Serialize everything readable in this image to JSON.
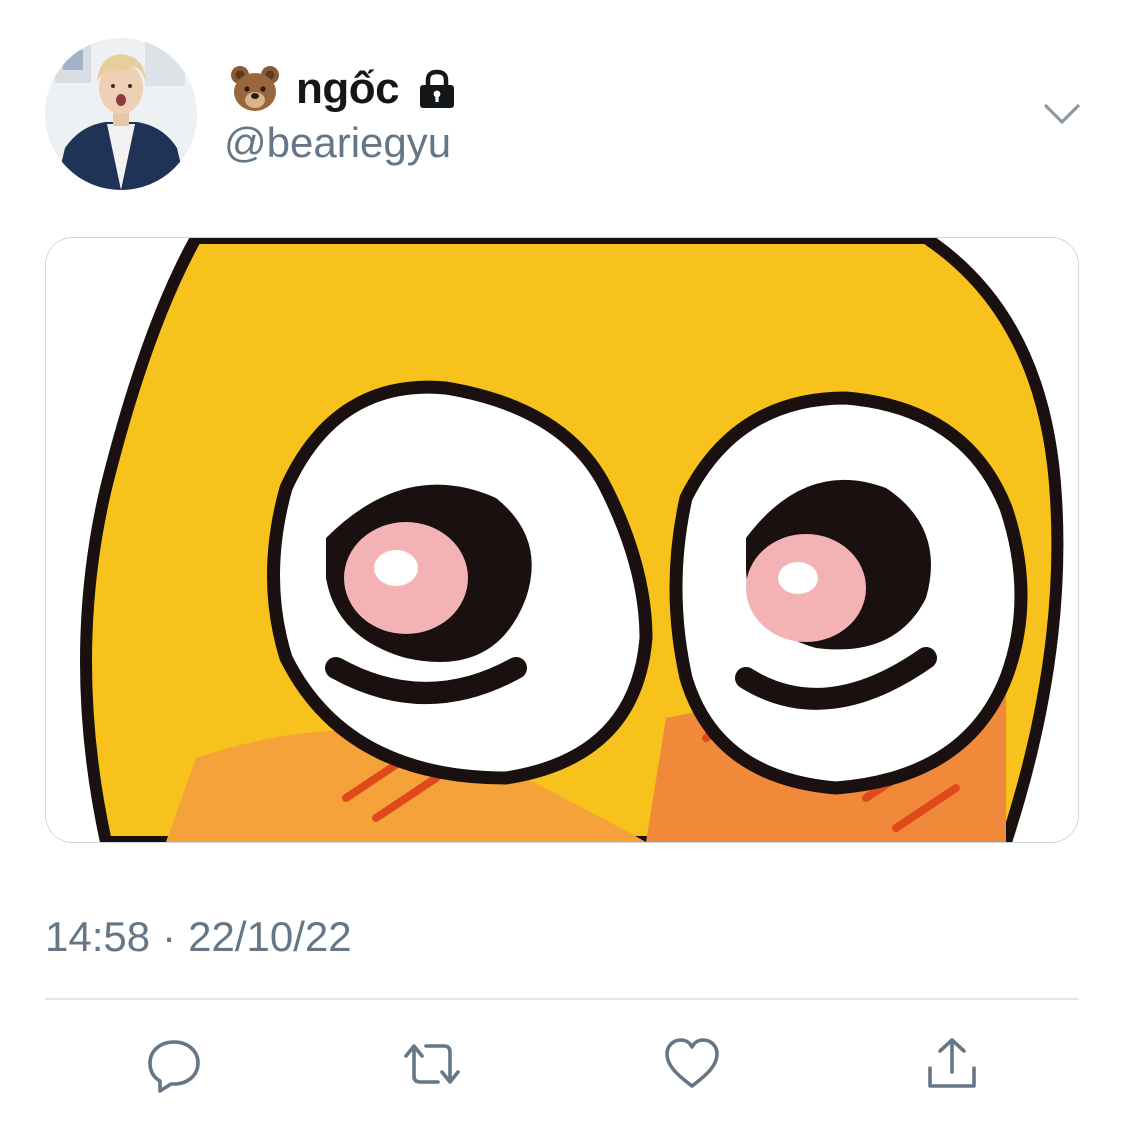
{
  "tweet": {
    "author": {
      "display_name": "ngốc",
      "handle": "@beariegyu",
      "name_emoji": "bear-face-icon",
      "protected_icon": "lock-icon",
      "avatar": "profile-photo"
    },
    "menu_icon": "chevron-down-icon",
    "media": {
      "description_icon": "duck-eyes-image"
    },
    "time": "14:58",
    "separator": "·",
    "date": "22/10/22",
    "actions": [
      {
        "name": "reply",
        "icon": "reply-icon"
      },
      {
        "name": "retweet",
        "icon": "retweet-icon"
      },
      {
        "name": "like",
        "icon": "heart-icon"
      },
      {
        "name": "share",
        "icon": "share-icon"
      }
    ]
  },
  "colors": {
    "text_primary": "#14171a",
    "text_secondary": "#657786",
    "icon_gray": "#657786",
    "border": "#ccd6dd",
    "divider": "#e1e8ed",
    "duck_yellow": "#f7c21c",
    "blush_orange": "#f08a3a"
  }
}
